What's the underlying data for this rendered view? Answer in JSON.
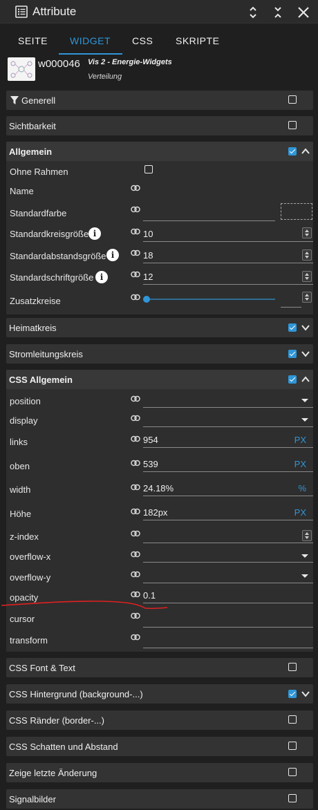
{
  "window": {
    "title": "Attribute",
    "icons": [
      "list-icon",
      "expand-icon",
      "collapse-icon",
      "close-icon"
    ]
  },
  "tabs": [
    {
      "label": "SEITE",
      "active": false
    },
    {
      "label": "WIDGET",
      "active": true
    },
    {
      "label": "CSS",
      "active": false
    },
    {
      "label": "SKRIPTE",
      "active": false
    }
  ],
  "widget": {
    "id": "w000046",
    "set": "Vis 2 - Energie-Widgets",
    "type": "Verteilung"
  },
  "sections": {
    "generell": {
      "label": "Generell",
      "checked": false
    },
    "sichtbarkeit": {
      "label": "Sichtbarkeit",
      "checked": false
    },
    "allgemein": {
      "label": "Allgemein",
      "checked": true,
      "expanded": true
    },
    "heimatkreis": {
      "label": "Heimatkreis",
      "checked": true
    },
    "stromleitungskreis": {
      "label": "Stromleitungskreis",
      "checked": true
    },
    "css_allgemein": {
      "label": "CSS Allgemein",
      "checked": true,
      "expanded": true
    },
    "css_font": {
      "label": "CSS Font & Text",
      "checked": false
    },
    "css_bg": {
      "label": "CSS Hintergrund (background-...)",
      "checked": true
    },
    "css_border": {
      "label": "CSS Ränder (border-...)",
      "checked": false
    },
    "css_shadow": {
      "label": "CSS Schatten und Abstand",
      "checked": false
    },
    "last_change": {
      "label": "Zeige letzte Änderung",
      "checked": false
    },
    "signal": {
      "label": "Signalbilder",
      "checked": false
    }
  },
  "allgemein": {
    "ohne_rahmen": {
      "label": "Ohne Rahmen",
      "checked": false
    },
    "name": {
      "label": "Name",
      "value": ""
    },
    "standardfarbe": {
      "label": "Standardfarbe",
      "value": ""
    },
    "kreisgroesse": {
      "label": "Standardkreisgröße",
      "value": "10"
    },
    "abstandsgroesse": {
      "label": "Standardabstandsgröße",
      "value": "18"
    },
    "schriftgroesse": {
      "label": "Standardschriftgröße",
      "value": "12"
    },
    "zusatzkreise": {
      "label": "Zusatzkreise",
      "value": ""
    },
    "info_glyph": "i"
  },
  "css_allgemein": {
    "position": {
      "label": "position",
      "value": ""
    },
    "display": {
      "label": "display",
      "value": ""
    },
    "links": {
      "label": "links",
      "value": "954",
      "unit": "PX"
    },
    "oben": {
      "label": "oben",
      "value": "539",
      "unit": "PX"
    },
    "width": {
      "label": "width",
      "value": "24.18%",
      "unit": "%"
    },
    "hoehe": {
      "label": "Höhe",
      "value": "182px",
      "unit": "PX"
    },
    "zindex": {
      "label": "z-index",
      "value": ""
    },
    "overflow_x": {
      "label": "overflow-x",
      "value": ""
    },
    "overflow_y": {
      "label": "overflow-y",
      "value": ""
    },
    "opacity": {
      "label": "opacity",
      "value": "0.1"
    },
    "cursor": {
      "label": "cursor",
      "value": ""
    },
    "transform": {
      "label": "transform",
      "value": ""
    }
  },
  "colors": {
    "accent": "#2f96d8",
    "annotation": "#e02020",
    "panel": "#2e2e2e",
    "bar": "#333333",
    "background": "#1f1f1f"
  }
}
